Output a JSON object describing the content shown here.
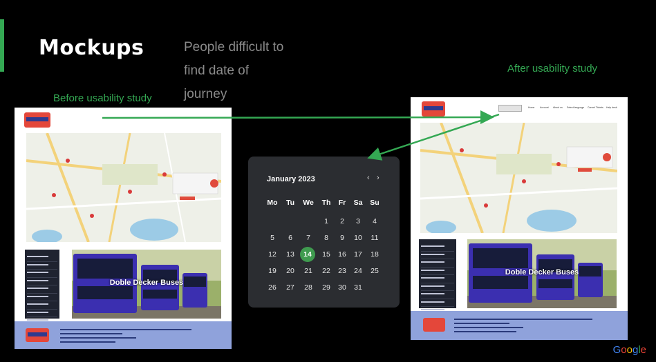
{
  "slide": {
    "title": "Mockups",
    "note": "People difficult to find date of journey",
    "before_label": "Before usability study",
    "after_label": "After usability study",
    "brand": "Google"
  },
  "mockup_after": {
    "nav": [
      "Home",
      "Account",
      "About us",
      "Select language",
      "Cancel Tickets",
      "Help desk"
    ]
  },
  "banner": {
    "caption": "Doble Decker Buses"
  },
  "calendar": {
    "month": "January 2023",
    "prev": "‹",
    "next": "›",
    "weekdays": [
      "Mo",
      "Tu",
      "We",
      "Th",
      "Fr",
      "Sa",
      "Su"
    ],
    "weeks": [
      [
        "",
        "",
        "",
        "",
        "",
        "",
        ""
      ],
      [
        "",
        "",
        "",
        "1",
        "2",
        "3",
        "4"
      ],
      [
        "5",
        "6",
        "7",
        "8",
        "9",
        "10",
        "11"
      ],
      [
        "12",
        "13",
        "14",
        "15",
        "16",
        "17",
        "18"
      ],
      [
        "19",
        "20",
        "21",
        "22",
        "23",
        "24",
        "25"
      ],
      [
        "26",
        "27",
        "28",
        "29",
        "30",
        "31",
        ""
      ]
    ],
    "selected": "14",
    "accent": "#3f9b4f"
  },
  "colors": {
    "accent_green": "#34a853",
    "background": "#000000",
    "calendar_bg": "#2b2d31",
    "footer": "#8fa2db"
  }
}
